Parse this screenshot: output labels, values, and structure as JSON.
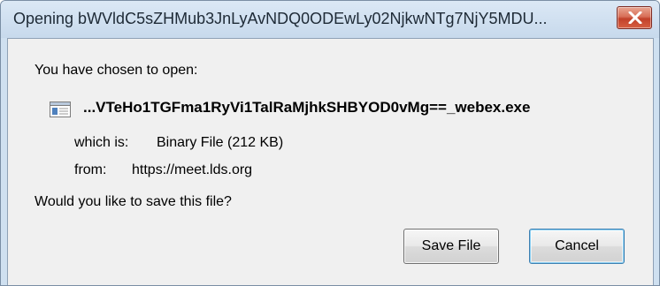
{
  "window": {
    "title": "Opening bWVldC5sZHMub3JnLyAvNDQ0ODEwLy02NjkwNTg7NjY5MDU..."
  },
  "dialog": {
    "intro": "You have chosen to open:",
    "file_name": "...VTeHo1TGFma1RyVi1TalRaMjhkSHBYOD0vMg==_webex.exe",
    "which_is_label": "which is:",
    "which_is_value": "Binary File (212 KB)",
    "from_label": "from:",
    "from_value": "https://meet.lds.org",
    "question": "Would you like to save this file?"
  },
  "buttons": {
    "save_label": "Save File",
    "cancel_label": "Cancel"
  },
  "icons": {
    "close": "close-icon",
    "file": "file-type-icon"
  }
}
